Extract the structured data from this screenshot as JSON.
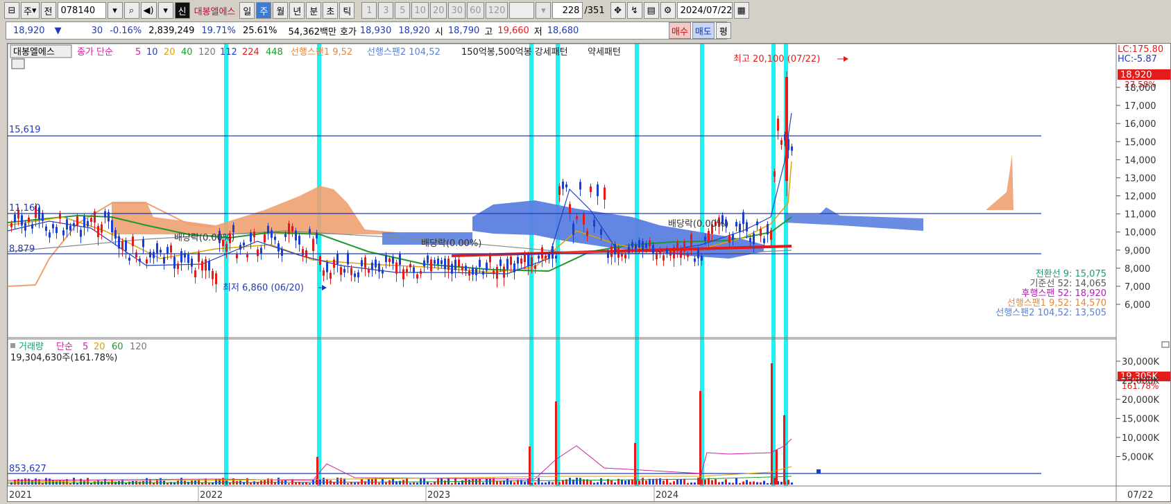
{
  "toolbar": {
    "period_label": "주",
    "compare_label": "전",
    "code": "078140",
    "badge": "신",
    "stock_name": "대봉엘에스",
    "tabs": [
      "일",
      "주",
      "월",
      "년",
      "분",
      "초",
      "틱"
    ],
    "active_tab": "주",
    "interval_buttons": [
      "1",
      "3",
      "5",
      "10",
      "20",
      "30",
      "60",
      "120"
    ],
    "count": "228",
    "count_total": "/351",
    "date": "2024/07/22"
  },
  "quote": {
    "price": "18,920",
    "arrow": "▼",
    "change": "30",
    "change_pct": "-0.16%",
    "volume": "2,839,249",
    "turnover_pct": "19.71%",
    "pct2": "25.61%",
    "amount": "54,362백만",
    "bid_label": "호가",
    "ask": "18,930",
    "bid": "18,920",
    "open_label": "시",
    "open": "18,790",
    "high_label": "고",
    "high": "19,660",
    "low_label": "저",
    "low": "18,680",
    "buy_label": "매수",
    "sell_label": "매도",
    "eval_label": "평"
  },
  "price_panel": {
    "legend": {
      "name": "대봉엘에스",
      "ma_label": "종가 단순",
      "ma_periods": [
        "5",
        "10",
        "20",
        "40",
        "120",
        "112",
        "224",
        "448"
      ],
      "span1": "선행스팬1 9,52",
      "span2": "선행스팬2 104,52",
      "pattern": "150억봉,500억봉 강세패턴",
      "pattern2": "약세패턴"
    },
    "max_label": "최고 20,100 (07/22)",
    "min_label": "최저 6,860 (06/20)",
    "dividend_labels": [
      "배당락(0.00%)",
      "배당락(0.00%)",
      "배당락(0.00%)"
    ],
    "hlines": [
      "15,619",
      "11,160",
      "8,879"
    ],
    "lc": "LC:175.80",
    "hc": "HC:-5.87",
    "current_price": "18,920",
    "current_pct": "27.58%",
    "axis_ticks": [
      "18,000",
      "17,000",
      "16,000",
      "15,000",
      "14,000",
      "13,000",
      "12,000",
      "11,000",
      "10,000",
      "9,000",
      "8,000",
      "7,000",
      "6,000"
    ],
    "ichimoku": [
      {
        "label": "전환선 9: 15,075",
        "color": "#1c9a6c"
      },
      {
        "label": "기준선 52: 14,065",
        "color": "#555555"
      },
      {
        "label": "후행스팬 52: 18,920",
        "color": "#b21fb2"
      },
      {
        "label": "선행스팬1 9,52: 14,570",
        "color": "#e8863a"
      },
      {
        "label": "선행스팬2 104,52: 13,505",
        "color": "#5b7fd6"
      }
    ]
  },
  "volume_panel": {
    "legend_label": "거래량",
    "ma_label": "단순",
    "ma_periods": [
      "5",
      "20",
      "60",
      "120"
    ],
    "total": "19,304,630주(161.78%)",
    "hline": "853,627",
    "axis_ticks": [
      "30,000K",
      "25,000K",
      "20,000K",
      "15,000K",
      "10,000K",
      "5,000K"
    ],
    "current_vol": "19,305K",
    "current_pct": "161.78%"
  },
  "x_axis": {
    "years": [
      "2021",
      "2022",
      "2023",
      "2024"
    ],
    "end": "07/22"
  },
  "colors": {
    "up": "#e31b1b",
    "down": "#1a3fd1",
    "highlight": "#22f0f0",
    "cloud_up": "#f0a070",
    "cloud_down": "#5b7fe0"
  }
}
